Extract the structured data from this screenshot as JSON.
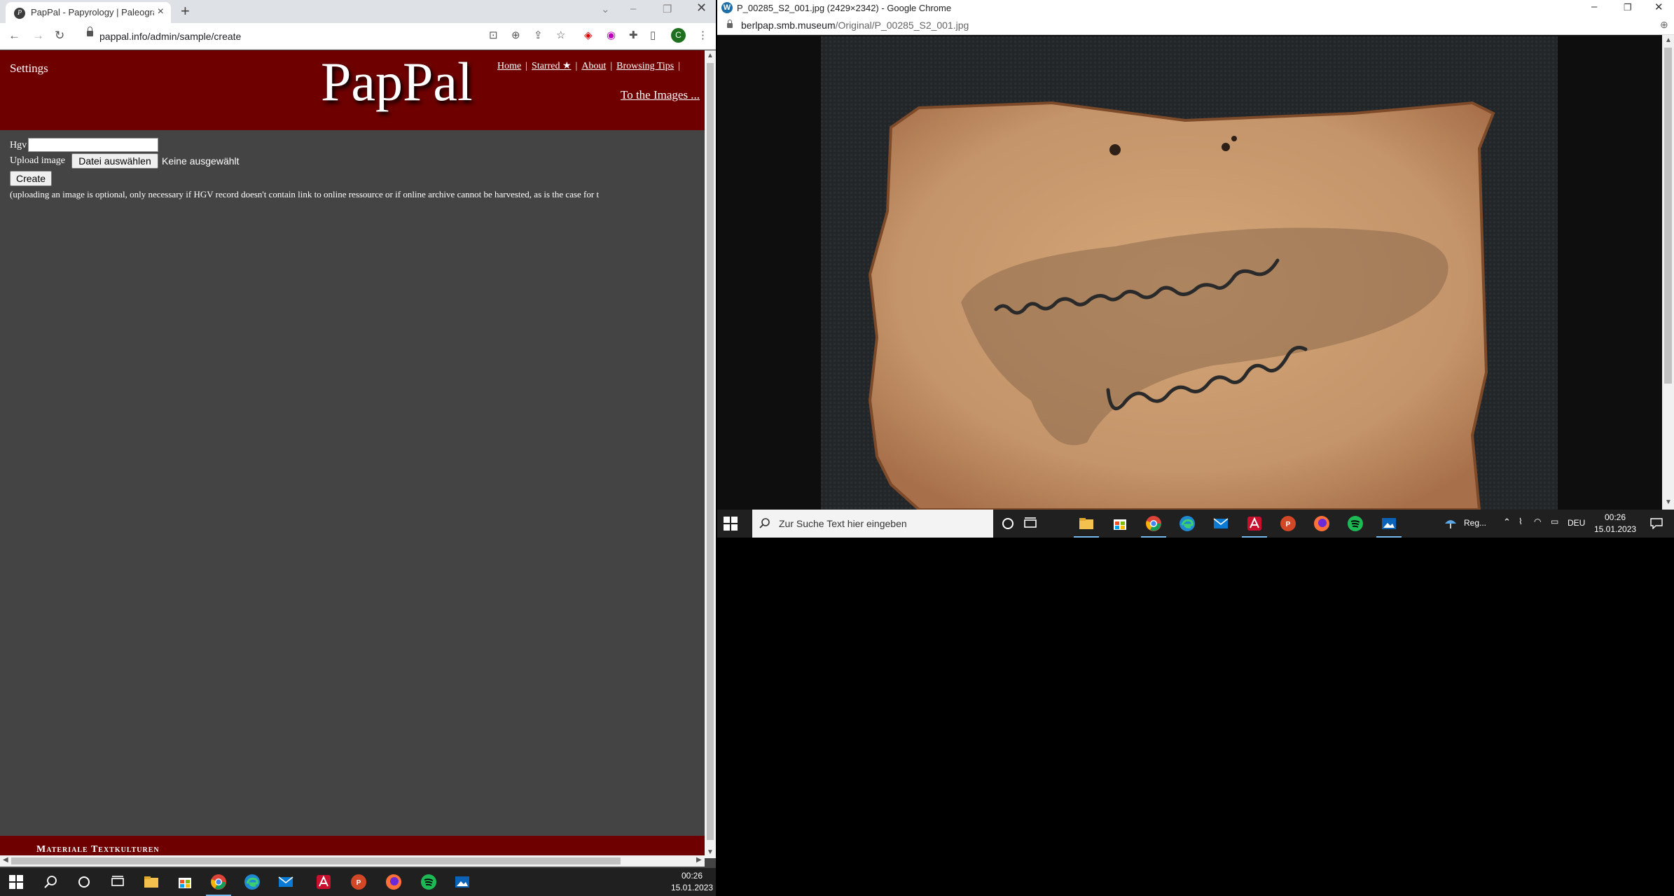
{
  "left_window": {
    "tab_title": "PapPal - Papyrology | Paleograph",
    "url": "pappal.info/admin/sample/create",
    "profile_initial": "C",
    "page": {
      "settings": "Settings",
      "logo": "PapPal",
      "nav": [
        "Home",
        "Starred ★",
        "About",
        "Browsing Tips"
      ],
      "to_images": "To the Images ...",
      "form": {
        "hgv_label": "Hgv",
        "hgv_value": "",
        "upload_label": "Upload image",
        "file_button": "Datei auswählen",
        "file_status": "Keine ausgewählt",
        "create_button": "Create",
        "note": "(uploading an image is optional, only necessary if HGV record doesn't contain link to online ressource or if online archive cannot be harvested, as is the case for t"
      },
      "footer": "Materiale Textkulturen"
    }
  },
  "right_window": {
    "title": "P_00285_S2_001.jpg (2429×2342) - Google Chrome",
    "url_host": "berlpap.smb.museum",
    "url_path": "/Original/P_00285_S2_001.jpg"
  },
  "taskbar_right": {
    "search_placeholder": "Zur Suche Text hier eingeben",
    "weather": "Reg...",
    "language": "DEU",
    "time": "00:26",
    "date": "15.01.2023"
  },
  "taskbar_left": {
    "time": "00:26",
    "date": "15.01.2023"
  },
  "colors": {
    "header_bg": "#6e0000",
    "page_bg": "#444444",
    "taskbar_bg": "#202020",
    "sherd": "#c99b6b"
  }
}
